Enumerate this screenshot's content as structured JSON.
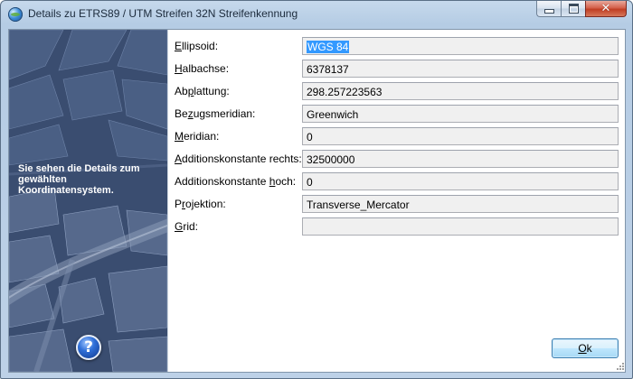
{
  "window": {
    "title": "Details zu ETRS89 / UTM Streifen 32N Streifenkennung",
    "controls": {
      "minimize": "minimize-icon",
      "maximize": "maximize-icon",
      "close": "close-icon"
    }
  },
  "side_panel": {
    "text": "Sie sehen die Details zum gewählten Koordinatensystem.",
    "help_glyph": "?"
  },
  "fields": [
    {
      "label_pre": "",
      "label_ul": "E",
      "label_post": "llipsoid:",
      "value": "WGS 84",
      "selected": true
    },
    {
      "label_pre": "",
      "label_ul": "H",
      "label_post": "albachse:",
      "value": "6378137"
    },
    {
      "label_pre": "Ab",
      "label_ul": "p",
      "label_post": "lattung:",
      "value": "298.257223563"
    },
    {
      "label_pre": "Be",
      "label_ul": "z",
      "label_post": "ugsmeridian:",
      "value": "Greenwich"
    },
    {
      "label_pre": "",
      "label_ul": "M",
      "label_post": "eridian:",
      "value": "0"
    },
    {
      "label_pre": "",
      "label_ul": "A",
      "label_post": "dditionskonstante rechts:",
      "value": "32500000"
    },
    {
      "label_pre": "Additionskonstante ",
      "label_ul": "h",
      "label_post": "och:",
      "value": "0"
    },
    {
      "label_pre": "P",
      "label_ul": "r",
      "label_post": "ojektion:",
      "value": "Transverse_Mercator"
    },
    {
      "label_pre": "",
      "label_ul": "G",
      "label_post": "rid:",
      "value": ""
    }
  ],
  "buttons": {
    "ok_pre": "",
    "ok_ul": "O",
    "ok_post": "k"
  },
  "colors": {
    "selection": "#3399ff",
    "field_bg": "#f0f0f0",
    "panel_bg": "#3b4f72"
  }
}
